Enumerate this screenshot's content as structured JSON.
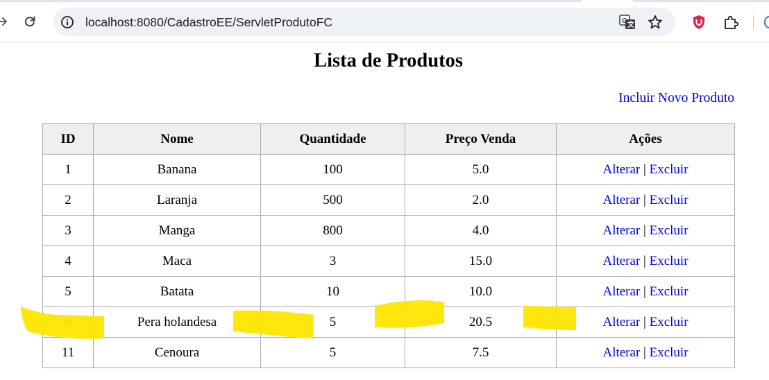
{
  "browser": {
    "url": "localhost:8080/CadastroEE/ServletProdutoFC",
    "icons": {
      "forward": "arrow-right-icon",
      "reload": "reload-icon",
      "site_info": "info-icon",
      "translate": "translate-icon",
      "bookmark": "star-icon",
      "extension": "shield-u-icon",
      "extensions_menu": "puzzle-icon"
    },
    "colors": {
      "omnibox_bg": "#eef1f6",
      "extension_red": "#d9264e"
    }
  },
  "page": {
    "title": "Lista de Produtos",
    "add_link": "Incluir Novo Produto",
    "link_color": "#0000ee"
  },
  "table": {
    "headers": [
      "ID",
      "Nome",
      "Quantidade",
      "Preço Venda",
      "Ações"
    ],
    "header_bg": "#efefef",
    "rows": [
      {
        "id": "1",
        "nome": "Banana",
        "quantidade": "100",
        "preco": "5.0",
        "alterar": "Alterar",
        "separador": "|",
        "excluir": "Excluir"
      },
      {
        "id": "2",
        "nome": "Laranja",
        "quantidade": "500",
        "preco": "2.0",
        "alterar": "Alterar",
        "separador": "|",
        "excluir": "Excluir"
      },
      {
        "id": "3",
        "nome": "Manga",
        "quantidade": "800",
        "preco": "4.0",
        "alterar": "Alterar",
        "separador": "|",
        "excluir": "Excluir"
      },
      {
        "id": "4",
        "nome": "Maca",
        "quantidade": "3",
        "preco": "15.0",
        "alterar": "Alterar",
        "separador": "|",
        "excluir": "Excluir"
      },
      {
        "id": "5",
        "nome": "Batata",
        "quantidade": "10",
        "preco": "10.0",
        "alterar": "Alterar",
        "separador": "|",
        "excluir": "Excluir"
      },
      {
        "id": "6",
        "nome": "Pera holandesa",
        "quantidade": "5",
        "preco": "20.5",
        "alterar": "Alterar",
        "separador": "|",
        "excluir": "Excluir"
      },
      {
        "id": "11",
        "nome": "Cenoura",
        "quantidade": "5",
        "preco": "7.5",
        "alterar": "Alterar",
        "separador": "|",
        "excluir": "Excluir"
      }
    ]
  },
  "annotations": {
    "highlighter_color": "#ffe600"
  }
}
